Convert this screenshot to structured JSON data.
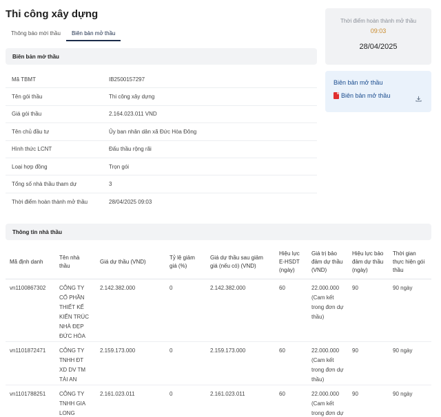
{
  "page_title": "Thi công xây dựng",
  "tabs": [
    {
      "label": "Thông báo mời thầu",
      "active": false
    },
    {
      "label": "Biên bản mở thầu",
      "active": true
    }
  ],
  "opening_section": {
    "title": "Biên bản mở thầu",
    "rows": [
      {
        "label": "Mã TBMT",
        "value": "IB2500157297"
      },
      {
        "label": "Tên gói thầu",
        "value": "Thi công xây dựng"
      },
      {
        "label": "Giá gói thầu",
        "value": "2.164.023.011 VND"
      },
      {
        "label": "Tên chủ đầu tư",
        "value": "Ủy ban nhân dân xã Đức Hòa Đông"
      },
      {
        "label": "Hình thức LCNT",
        "value": "Đấu thầu rộng rãi"
      },
      {
        "label": "Loại hợp đồng",
        "value": "Trọn gói"
      },
      {
        "label": "Tổng số nhà thầu tham dự",
        "value": "3"
      },
      {
        "label": "Thời điểm hoàn thành mở thầu",
        "value": "28/04/2025 09:03"
      }
    ]
  },
  "completion_card": {
    "label": "Thời điểm hoàn thành mở thầu",
    "time": "09:03",
    "date": "28/04/2025"
  },
  "document_card": {
    "title": "Biên bản mở thầu",
    "link_label": "Biên bản mở thầu",
    "file_icon": "pdf-icon",
    "action_icon": "download-icon"
  },
  "contractor_section": {
    "title": "Thông tin nhà thầu",
    "headers": [
      "Mã định danh",
      "Tên nhà thầu",
      "Giá dự thầu (VND)",
      "Tỷ lệ giảm giá (%)",
      "Giá dự thầu sau giảm giá (nếu có) (VND)",
      "Hiệu lực E-HSDT (ngày)",
      "Giá trị bảo đảm dự thầu (VND)",
      "Hiệu lực bảo đảm dự thầu (ngày)",
      "Thời gian thực hiện gói thầu"
    ],
    "rows": [
      {
        "id": "vn1100867302",
        "name": "CÔNG TY CỔ PHẦN THIẾT KẾ KIẾN TRÚC NHÀ ĐẸP ĐỨC HÒA",
        "bid_price": "2.142.382.000",
        "discount": "0",
        "price_after_discount": "2.142.382.000",
        "validity": "60",
        "guarantee_value": "22.000.000",
        "guarantee_note": "(Cam kết trong đơn dự thầu)",
        "guarantee_validity": "90",
        "duration": "90 ngày"
      },
      {
        "id": "vn1101872471",
        "name": "CÔNG TY TNHH ĐT XD DV TM TÀI AN",
        "bid_price": "2.159.173.000",
        "discount": "0",
        "price_after_discount": "2.159.173.000",
        "validity": "60",
        "guarantee_value": "22.000.000",
        "guarantee_note": "(Cam kết trong đơn dự thầu)",
        "guarantee_validity": "90",
        "duration": "90 ngày"
      },
      {
        "id": "vn1101788251",
        "name": "CÔNG TY TNHH GIA LONG LONG AN",
        "bid_price": "2.161.023.011",
        "discount": "0",
        "price_after_discount": "2.161.023.011",
        "validity": "60",
        "guarantee_value": "22.000.000",
        "guarantee_note": "(Cam kết trong đơn dự thầu)",
        "guarantee_validity": "90",
        "duration": "90 ngày"
      }
    ]
  },
  "colors": {
    "accent_navy": "#1a2b49",
    "time_orange": "#c98a2b",
    "link_blue": "#1b4d8f",
    "pdf_red": "#e02f2f"
  }
}
